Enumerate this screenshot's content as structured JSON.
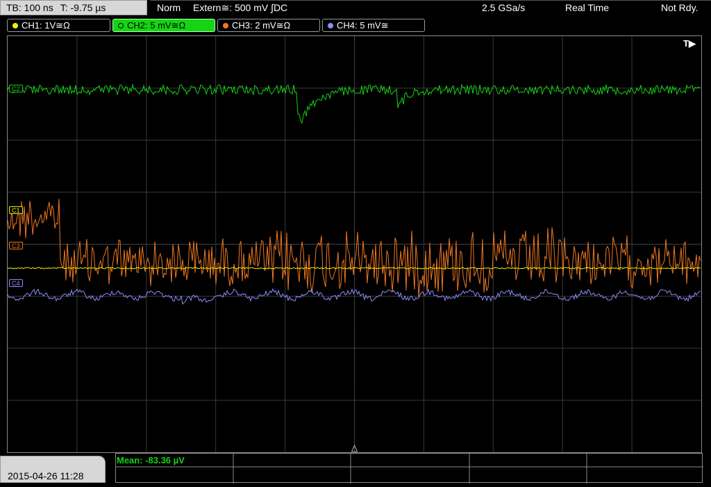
{
  "header": {
    "timebase": "TB: 100 ns",
    "trigger_time": "T: -9.75 µs",
    "mode": "Norm",
    "trigger_source": "Extern≅: 500 mV ∫DC",
    "sample_rate": "2.5 GSa/s",
    "acquisition": "Real Time",
    "status": "Not Rdy."
  },
  "channels": [
    {
      "id": "ch1",
      "label": "CH1: 1V≅Ω",
      "color": "#f2f200",
      "active": false
    },
    {
      "id": "ch2",
      "label": "CH2: 5 mV≅Ω",
      "color": "#14d414",
      "active": true
    },
    {
      "id": "ch3",
      "label": "CH3: 2 mV≅Ω",
      "color": "#f07820",
      "active": false
    },
    {
      "id": "ch4",
      "label": "CH4: 5 mV≅",
      "color": "#8c8cff",
      "active": false
    }
  ],
  "markers": {
    "c1": "C1",
    "c2": "C2",
    "c3": "C3",
    "c4": "C4",
    "trigger": "T▶"
  },
  "footer": {
    "datetime": "2015-04-26 11:28",
    "measurement": "Mean: -83.36 µV"
  },
  "colors": {
    "background": "#000000",
    "grid": "#3a3a3a",
    "panel": "#d7d7d7"
  }
}
